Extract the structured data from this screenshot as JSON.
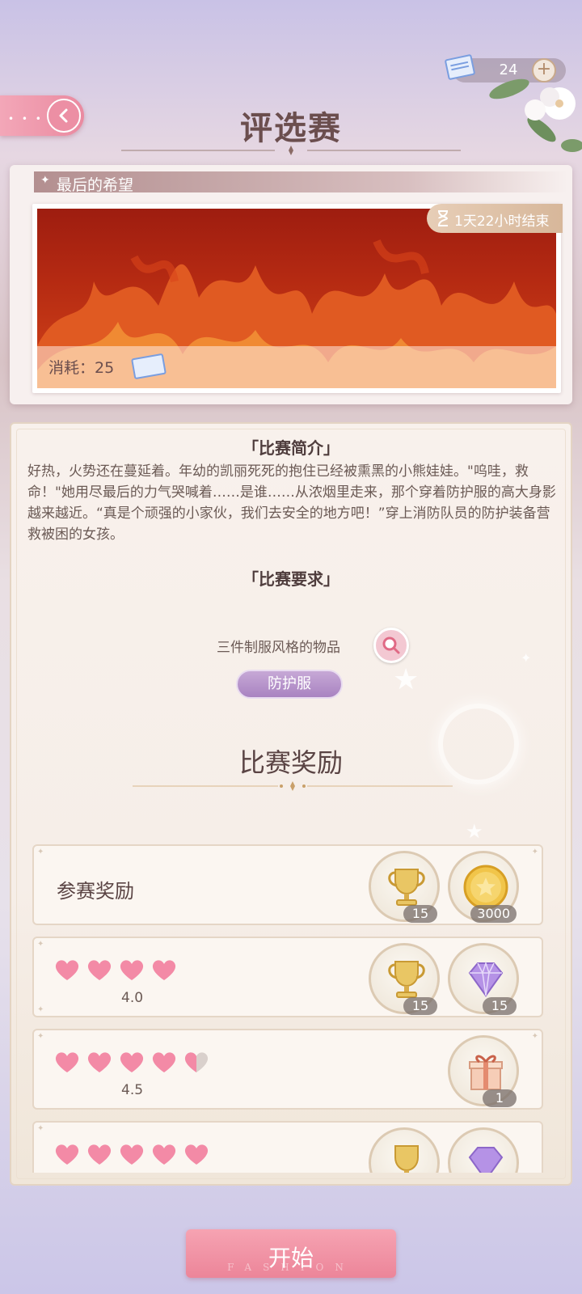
{
  "header": {
    "title": "评选赛",
    "ticket_count": "24",
    "plus_label": "+"
  },
  "event": {
    "name": "最后的希望",
    "timer": "1天22小时结束",
    "consume": "消耗：25"
  },
  "intro": {
    "title": "「比赛简介」",
    "text": "好热，火势还在蔓延着。年幼的凯丽死死的抱住已经被熏黑的小熊娃娃。\"呜哇，救命！\"她用尽最后的力气哭喊着……是谁……从浓烟里走来，那个穿着防护服的高大身影越来越近。“真是个顽强的小家伙，我们去安全的地方吧！”穿上消防队员的防护装备营救被困的女孩。"
  },
  "requirement": {
    "title": "「比赛要求」",
    "text": "三件制服风格的物品",
    "tag": "防护服"
  },
  "rewards": {
    "title": "比赛奖励",
    "rows": [
      {
        "label": "参赛奖励",
        "items": [
          {
            "icon": "trophy-icon",
            "qty": "15"
          },
          {
            "icon": "gold-coin-icon",
            "qty": "3000"
          }
        ]
      },
      {
        "score": "4.0",
        "hearts": 4,
        "items": [
          {
            "icon": "trophy-icon",
            "qty": "15"
          },
          {
            "icon": "diamond-icon",
            "qty": "15"
          }
        ]
      },
      {
        "score": "4.5",
        "hearts": 4.5,
        "items": [
          {
            "icon": "gift-box-icon",
            "qty": "1"
          }
        ]
      },
      {
        "score": "",
        "hearts": 5,
        "items": [
          {
            "icon": "trophy-icon",
            "qty": ""
          },
          {
            "icon": "diamond-icon",
            "qty": ""
          }
        ]
      }
    ]
  },
  "footer": {
    "start_label": "开始",
    "start_sub": "FASHION"
  },
  "colors": {
    "accent_pink": "#ec8fa4",
    "tag_purple": "#a983c1",
    "title_brown": "#6b4e4e"
  }
}
